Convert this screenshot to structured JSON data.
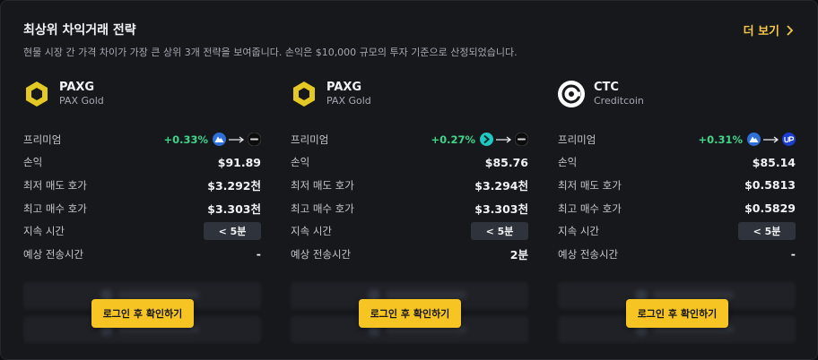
{
  "header": {
    "title": "최상위 차익거래 전략",
    "subtitle": "현물 시장 간 가격 차이가 가장 큰 상위 3개 전략을 보여줍니다. 손익은 $10,000 규모의 투자 기준으로 산정되었습니다.",
    "more_label": "더 보기"
  },
  "labels": {
    "premium": "프리미엄",
    "pnl": "손익",
    "lowest_ask": "최저 매도 호가",
    "highest_bid": "최고 매수 호가",
    "duration": "지속 시간",
    "transfer_time": "예상 전송시간",
    "login_button": "로그인 후 확인하기"
  },
  "cards": [
    {
      "symbol": "PAXG",
      "name": "PAX Gold",
      "icon": "paxg-icon",
      "premium": "+0.33%",
      "from_exchange": "upbit-mountain-icon",
      "to_exchange": "bithumb-icon",
      "pnl": "$91.89",
      "lowest_ask": "$3.292천",
      "highest_bid": "$3.303천",
      "duration": "< 5분",
      "transfer_time": "-"
    },
    {
      "symbol": "PAXG",
      "name": "PAX Gold",
      "icon": "paxg-icon",
      "premium": "+0.27%",
      "from_exchange": "korbit-icon",
      "to_exchange": "bithumb-icon",
      "pnl": "$85.76",
      "lowest_ask": "$3.294천",
      "highest_bid": "$3.303천",
      "duration": "< 5분",
      "transfer_time": "2분"
    },
    {
      "symbol": "CTC",
      "name": "Creditcoin",
      "icon": "creditcoin-icon",
      "premium": "+0.31%",
      "from_exchange": "upbit-mountain-icon",
      "to_exchange": "upbit-icon",
      "pnl": "$85.14",
      "lowest_ask": "$0.5813",
      "highest_bid": "$0.5829",
      "duration": "< 5분",
      "transfer_time": "-"
    }
  ],
  "colors": {
    "accent": "#f7c523",
    "positive": "#3ed68a",
    "background": "#17181c"
  }
}
